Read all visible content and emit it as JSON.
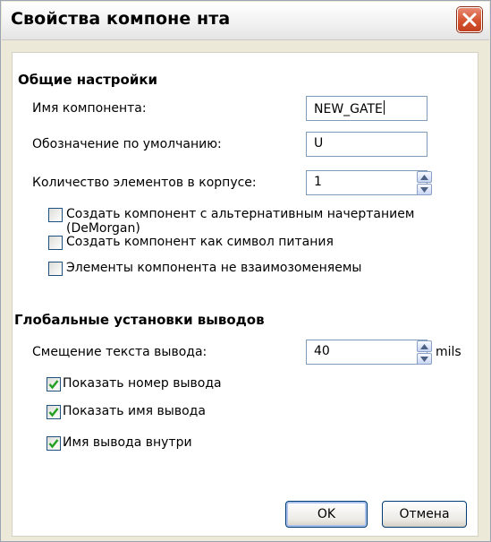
{
  "window": {
    "title": "Свойства компоне нта",
    "close_icon": "close-icon"
  },
  "general": {
    "heading": "Общие настройки",
    "component_name_label": "Имя компонента:",
    "component_name_value": "NEW_GATE",
    "default_designator_label": "Обозначение по умолчанию:",
    "default_designator_value": "U",
    "elements_count_label": "Количество элементов в корпусе:",
    "elements_count_value": "1",
    "checkboxes": [
      {
        "label": "Создать компонент с альтернативным начертанием (DeMorgan)",
        "checked": false
      },
      {
        "label": "Создать компонент как символ питания",
        "checked": false
      },
      {
        "label": "Элементы компонента не взаимозоменяемы",
        "checked": false
      }
    ]
  },
  "pins": {
    "heading": "Глобальные установки выводов",
    "text_offset_label": "Смещение текста вывода:",
    "text_offset_value": "40",
    "text_offset_unit": "mils",
    "checkboxes": [
      {
        "label": "Показать номер вывода",
        "checked": true
      },
      {
        "label": "Показать имя вывода",
        "checked": true
      },
      {
        "label": "Имя вывода внутри",
        "checked": true
      }
    ]
  },
  "buttons": {
    "ok": "OK",
    "cancel": "Отмена"
  },
  "colors": {
    "accent_check": "#21a121",
    "close_red": "#d4522f",
    "field_border": "#7f9db9"
  }
}
